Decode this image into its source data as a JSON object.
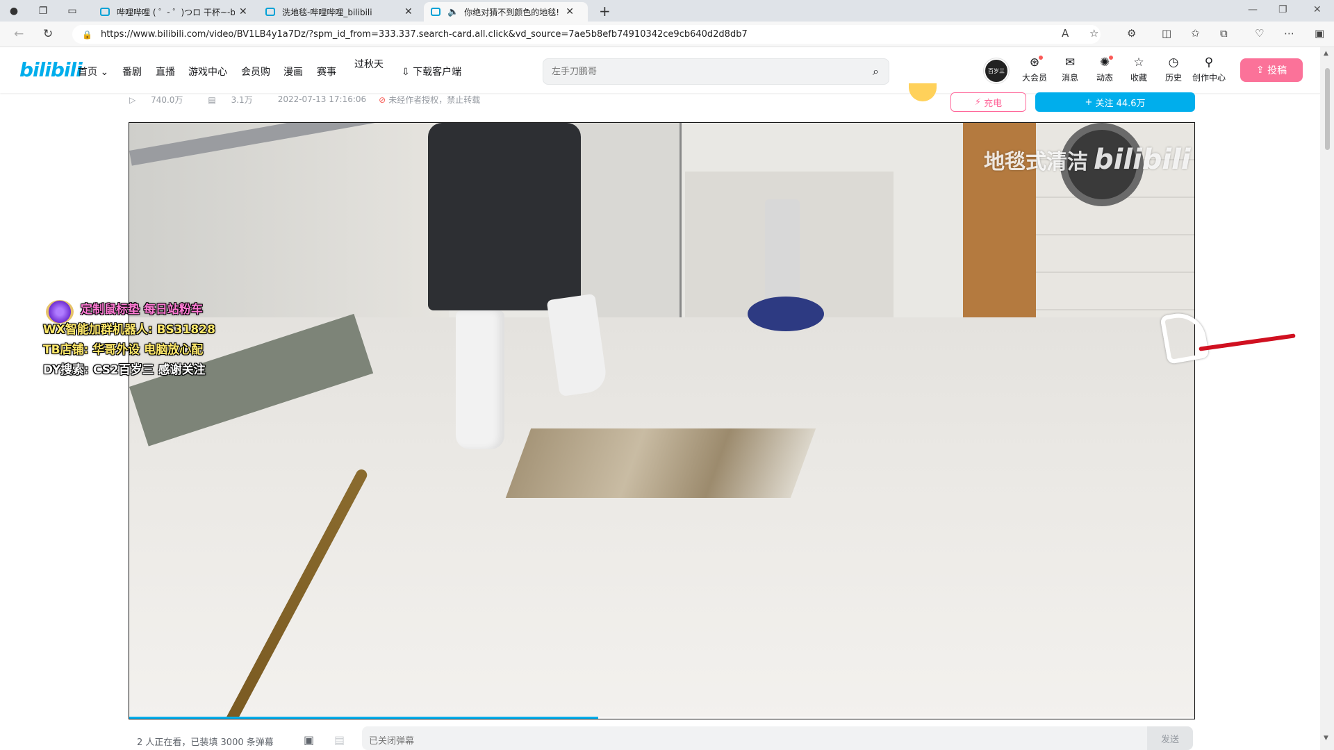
{
  "browser": {
    "tabs": [
      {
        "title": "哔哩哔哩 ( ゜- ゜)つロ 干杯~-bilibili",
        "active": false
      },
      {
        "title": "洗地毯-哔哩哔哩_bilibili",
        "active": false
      },
      {
        "title": "你绝对猜不到颜色的地毯!",
        "active": true
      }
    ],
    "url": "https://www.bilibili.com/video/BV1LB4y1a7Dz/?spm_id_from=333.337.search-card.all.click&vd_source=7ae5b8efb74910342ce9cb640d2d8db7"
  },
  "header": {
    "logo": "bilibili",
    "nav": [
      "首页",
      "番剧",
      "直播",
      "游戏中心",
      "会员购",
      "漫画",
      "赛事",
      "过秋天",
      "下载客户端"
    ],
    "search_placeholder": "左手刀鹏哥",
    "avatar_text": "百岁三",
    "icons": [
      {
        "label": "大会员",
        "icon": "vip-icon",
        "dot": true
      },
      {
        "label": "消息",
        "icon": "message-icon",
        "dot": false
      },
      {
        "label": "动态",
        "icon": "dynamic-icon",
        "dot": true
      },
      {
        "label": "收藏",
        "icon": "star-icon",
        "dot": false
      },
      {
        "label": "历史",
        "icon": "clock-icon",
        "dot": false
      },
      {
        "label": "创作中心",
        "icon": "bulb-icon",
        "dot": false
      }
    ],
    "upload_label": "投稿",
    "accent": "#00aeec",
    "pink": "#fb7299"
  },
  "video": {
    "views": "740.0万",
    "danmaku_count": "3.1万",
    "date": "2022-07-13 17:16:06",
    "notice": "未经作者授权，禁止转载",
    "charge_label": "充电",
    "follow_label": "关注 44.6万",
    "watermark_text": "地毯式清洁",
    "watermark_logo": "bilibili",
    "progress": 0.44
  },
  "overlay": {
    "line1": "定制鼠标垫 每日站粉车",
    "line2": "WX智能加群机器人: BS31828",
    "line3": "TB店铺: 华哥外设  电脑放心配",
    "line4": "DY搜索: CS2百岁三 感谢关注"
  },
  "danmaku": {
    "info": "2 人正在看，已装填 3000 条弹幕",
    "input_placeholder": "已关闭弹幕",
    "send_label": "发送"
  }
}
